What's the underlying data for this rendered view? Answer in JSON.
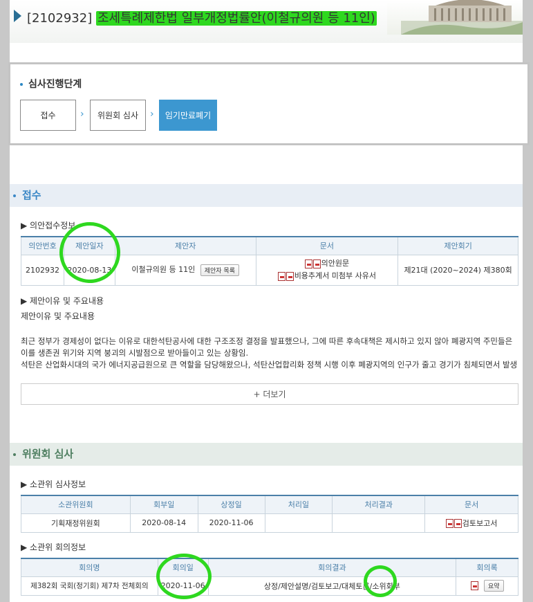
{
  "header": {
    "bill_no": "[2102932]",
    "bill_title": "조세특례제한법 일부개정법률안(이철규의원 등 11인)"
  },
  "stage": {
    "title": "심사진행단계",
    "steps": [
      "접수",
      "위원회 심사",
      "임기만료폐기"
    ]
  },
  "reception": {
    "section_title": "접수",
    "info_heading": "▶ 의안접수정보",
    "columns": [
      "의안번호",
      "제안일자",
      "제안자",
      "문서",
      "제안회기"
    ],
    "row": {
      "bill_no": "2102932",
      "date": "2020-08-13",
      "proposer": "이철규의원 등 11인",
      "proposer_btn": "제안자 목록",
      "doc1": "의안원문",
      "doc2": "비용추계서 미첨부 사유서",
      "session": "제21대 (2020~2024) 제380회"
    },
    "reason_heading": "▶ 제안이유 및 주요내용",
    "reason_label": "제안이유 및 주요내용",
    "lines": [
      "최근 정부가 경제성이 없다는 이유로 대한석탄공사에 대한 구조조정 결정을 발표했으나, 그에 따른 후속대책은 제시하고 있지 않아 폐광지역 주민들은",
      "이를 생존권 위기와 지역 붕괴의 시발점으로 받아들이고 있는 상황임.",
      "석탄은 산업화시대의 국가 에너지공급원으로 큰 역할을 담당해왔으나, 석탄산업합리화 정책 시행 이후 폐광지역의 인구가 줄고 경기가 침체되면서 발생"
    ],
    "more": "+ 더보기"
  },
  "committee": {
    "section_title": "위원회 심사",
    "review_heading": "▶ 소관위 심사정보",
    "review_columns": [
      "소관위원회",
      "회부일",
      "상정일",
      "처리일",
      "처리결과",
      "문서"
    ],
    "review_row": {
      "committee": "기획재정위원회",
      "referred": "2020-08-14",
      "presented": "2020-11-06",
      "processed": "",
      "result": "",
      "doc": "검토보고서"
    },
    "meeting_heading": "▶ 소관위 회의정보",
    "meeting_columns": [
      "회의명",
      "회의일",
      "회의결과",
      "회의록"
    ],
    "meeting_row": {
      "name": "제382회 국회(정기회) 제7차 전체회의",
      "date": "2020-11-06",
      "result": "상정/제안설명/검토보고/대체토론/소위회부",
      "minutes_btn": "요약"
    }
  }
}
